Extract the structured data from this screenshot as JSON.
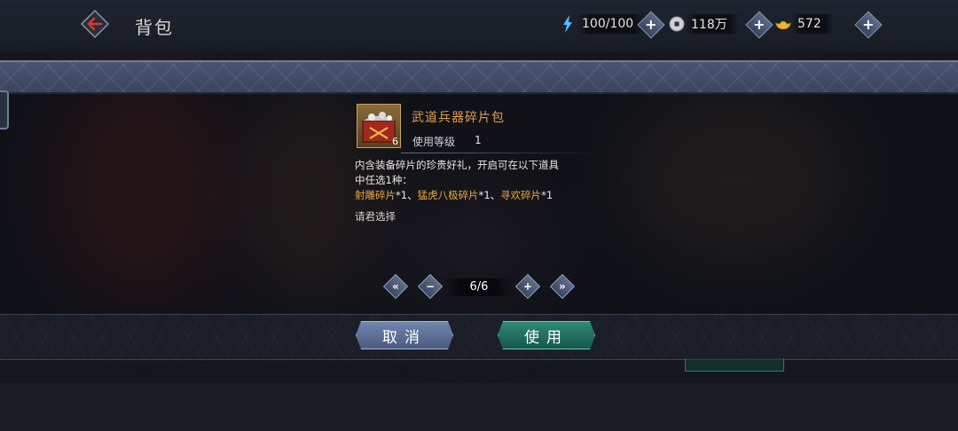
{
  "header": {
    "title": "背包",
    "resources": [
      {
        "icon": "energy-bolt-icon",
        "value": "100/100"
      },
      {
        "icon": "coin-icon",
        "value": "118万"
      },
      {
        "icon": "gold-ingot-icon",
        "value": "572"
      }
    ]
  },
  "item": {
    "name": "武道兵器碎片包",
    "count": "6",
    "level_label": "使用等级",
    "level_value": "1",
    "description_lines": [
      "内含装备碎片的珍贵好礼，开启可在以下道具",
      "中任选1种："
    ],
    "options": [
      {
        "name": "射雕碎片",
        "qty": "*1"
      },
      {
        "name": "猛虎八极碎片",
        "qty": "*1"
      },
      {
        "name": "寻欢碎片",
        "qty": "*1"
      }
    ],
    "separator": "、",
    "prompt": "请君选择"
  },
  "pager": {
    "display": "6/6"
  },
  "buttons": {
    "cancel": "取消",
    "use": "使用"
  },
  "colors": {
    "item_name": "#e49d4e",
    "option_gold": "#e8a93f",
    "cancel_button": "#5a6d94",
    "use_button": "#20705d"
  }
}
